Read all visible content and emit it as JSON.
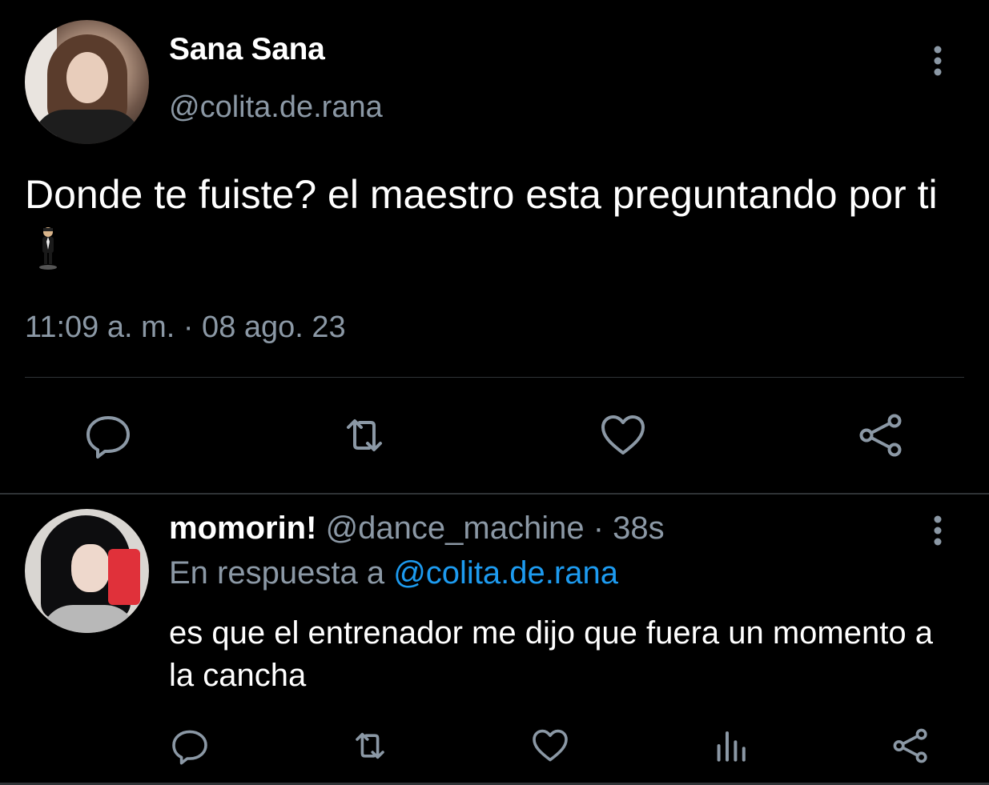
{
  "main_tweet": {
    "display_name": "Sana Sana",
    "handle": "@colita.de.rana",
    "text": "Donde te fuiste? el maestro esta preguntando por ti",
    "emoji": "man-in-business-suit-levitating",
    "timestamp": "11:09 a. m. · 08 ago. 23",
    "actions": [
      "reply-icon",
      "retweet-icon",
      "like-icon",
      "share-icon"
    ]
  },
  "reply_tweet": {
    "display_name": "momorin!",
    "handle": "@dance_machine",
    "separator": "·",
    "time_ago": "38s",
    "in_reply_to_prefix": "En respuesta a",
    "in_reply_to_handle": "@colita.de.rana",
    "text": "es que el entrenador me dijo que fuera un momento a la cancha",
    "actions": [
      "reply-icon",
      "retweet-icon",
      "like-icon",
      "analytics-icon",
      "share-icon"
    ]
  },
  "colors": {
    "background": "#000000",
    "text_primary": "#ffffff",
    "text_secondary": "#8b98a5",
    "link": "#1d9bf0",
    "divider": "#2f3336"
  }
}
